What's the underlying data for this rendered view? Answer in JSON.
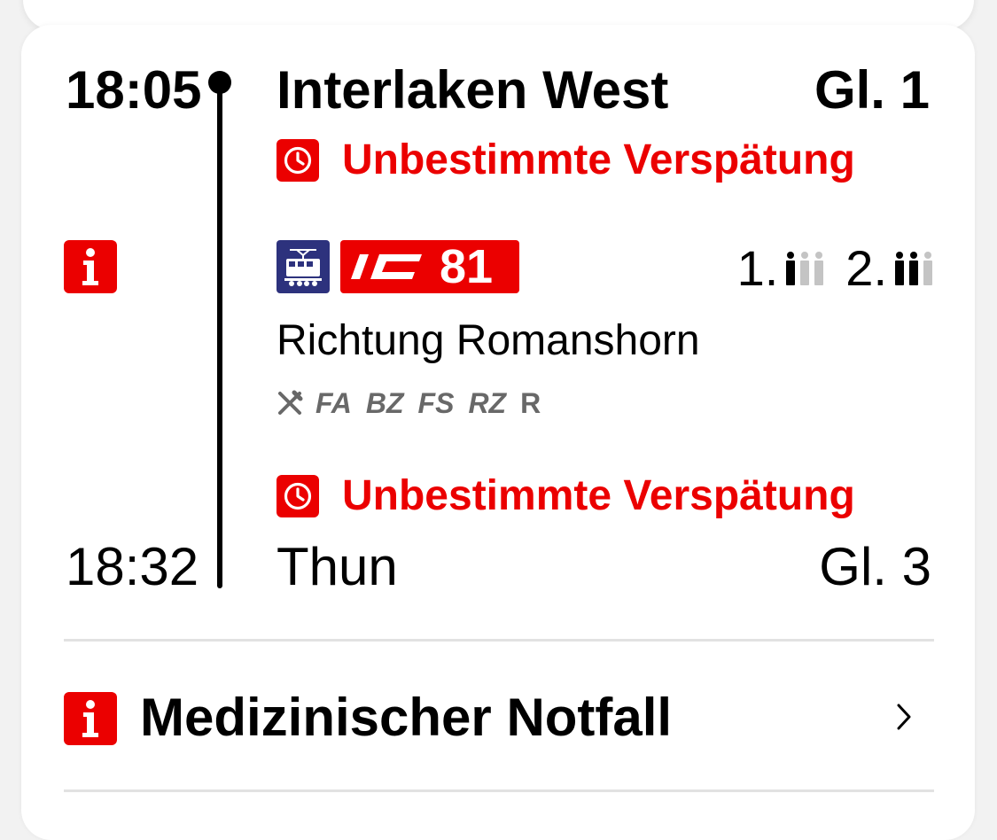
{
  "departure": {
    "time": "18:05",
    "station": "Interlaken West",
    "platform": "Gl. 1",
    "delay": "Unbestimmte Verspätung"
  },
  "train": {
    "category": "IC",
    "number": "81",
    "direction": "Richtung Romanshorn",
    "occupancy": {
      "first_class_label": "1.",
      "second_class_label": "2."
    },
    "features": [
      "FA",
      "BZ",
      "FS",
      "RZ",
      "R"
    ]
  },
  "arrival": {
    "delay": "Unbestimmte Verspätung",
    "time": "18:32",
    "station": "Thun",
    "platform": "Gl. 3"
  },
  "notice": {
    "title": "Medizinischer Notfall"
  },
  "colors": {
    "accent_red": "#eb0000",
    "transport_blue": "#2d327d",
    "feature_grey": "#686868"
  },
  "icons": {
    "delay": "clock-icon",
    "info": "info-icon",
    "transport": "locomotive-icon",
    "occupancy": "person-icon",
    "restaurant": "cutlery-icon",
    "chevron": "chevron-right-icon"
  }
}
